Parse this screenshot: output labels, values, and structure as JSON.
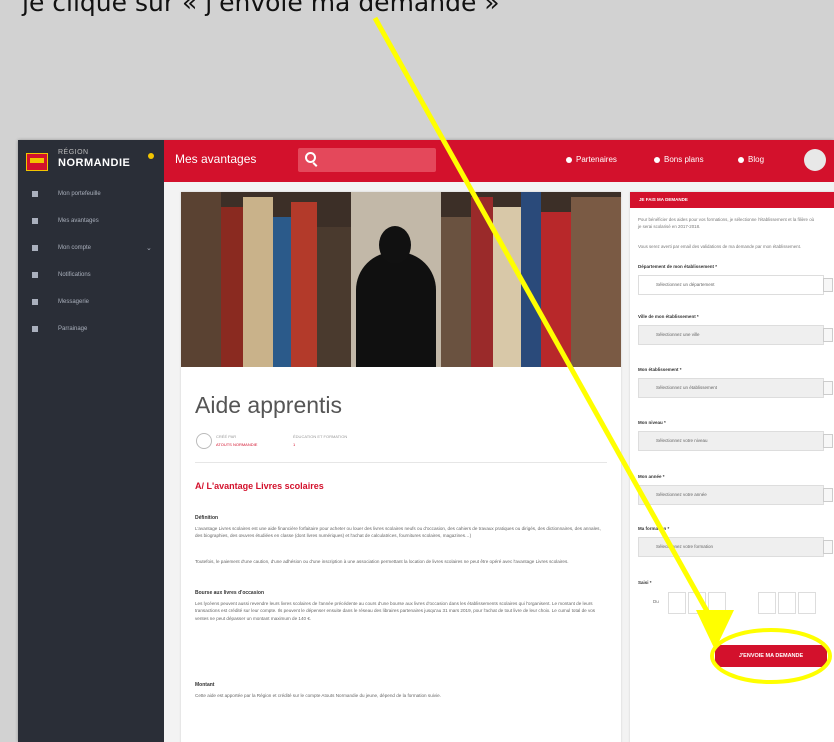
{
  "caption": "je clique sur « j'envoie ma demande »",
  "header": {
    "logo_small": "RÉGION",
    "logo_big": "NORMANDIE",
    "title": "Mes avantages",
    "search_placeholder": "",
    "nav": [
      "Partenaires",
      "Bons plans",
      "Blog"
    ]
  },
  "sidebar": {
    "items": [
      {
        "label": "Mon portefeuille"
      },
      {
        "label": "Mes avantages"
      },
      {
        "label": "Mon compte"
      },
      {
        "label": "Notifications"
      },
      {
        "label": "Messagerie"
      },
      {
        "label": "Parrainage"
      }
    ]
  },
  "article": {
    "title": "Aide apprentis",
    "author_role": "CRÉÉ PAR",
    "author_name": "ATOUTS NORMANDIE",
    "meta": "ÉDUCATION ET FORMATION",
    "meta_count": "1",
    "section_title": "A/ L'avantage Livres scolaires",
    "blocks": [
      {
        "heading": "Définition",
        "text": "L'avantage Livres scolaires est une aide financière forfaitaire pour acheter ou louer des livres scolaires neufs ou d'occasion, des cahiers de travaux pratiques ou dirigés, des dictionnaires, des annales, des biographies, des œuvres étudiées en classe (dont livres numériques) et l'achat de calculatrices, fournitures scolaires, magazines…)"
      },
      {
        "heading": "",
        "text": "Toutefois, le paiement d'une caution, d'une adhésion ou d'une inscription à une association permettant la location de livres scolaires ne peut être opéré avec l'avantage Livres scolaires."
      },
      {
        "heading": "Bourse aux livres d'occasion",
        "text": "Les lycéens peuvent aussi revendre leurs livres scolaires de l'année précédente au cours d'une bourse aux livres d'occasion dans les établissements scolaires qui l'organisent. Le montant de leurs transactions est crédité sur leur compte. Ils peuvent le dépenser ensuite dans le réseau des libraires partenaires jusqu'au 31 mars 2019, pour l'achat de tout livre de leur choix. Le cumul total de vos ventes ne peut dépasser un montant maximum de 140 €."
      },
      {
        "heading": "Montant",
        "text": "Cette aide est apportée par la Région et crédité sur le compte Atouts Normandie du jeune, dépend de la formation suivie."
      }
    ]
  },
  "panel": {
    "header": "JE FAIS MA DEMANDE",
    "intro_1": "Pour bénéficier des aides pour vos formations, je sélectionne l'établissement et la filière où je serai scolarisé en 2017-2018.",
    "intro_2": "Vous serez averti par email des validations de ma demande par mon établissement.",
    "fields": [
      {
        "label": "Département de mon établissement *",
        "placeholder": "Sélectionnez un département"
      },
      {
        "label": "Ville de mon établissement *",
        "placeholder": "Sélectionnez une ville"
      },
      {
        "label": "Mon établissement *",
        "placeholder": "Sélectionnez un établissement"
      },
      {
        "label": "Mon niveau *",
        "placeholder": "Sélectionnez votre niveau"
      },
      {
        "label": "Mon année *",
        "placeholder": "Sélectionnez votre année"
      },
      {
        "label": "Ma formation *",
        "placeholder": "Sélectionnez votre formation"
      }
    ],
    "date_label": "Saisi *",
    "date_prefix": "Du",
    "submit": "J'ENVOIE MA DEMANDE"
  },
  "colors": {
    "brand_red": "#d3112c",
    "sidebar": "#2a2e37",
    "annotation_yellow": "#ffff00"
  },
  "icons": [
    "location-pin-icon",
    "bulb-icon",
    "blog-icon",
    "search-icon",
    "user-avatar-icon"
  ]
}
